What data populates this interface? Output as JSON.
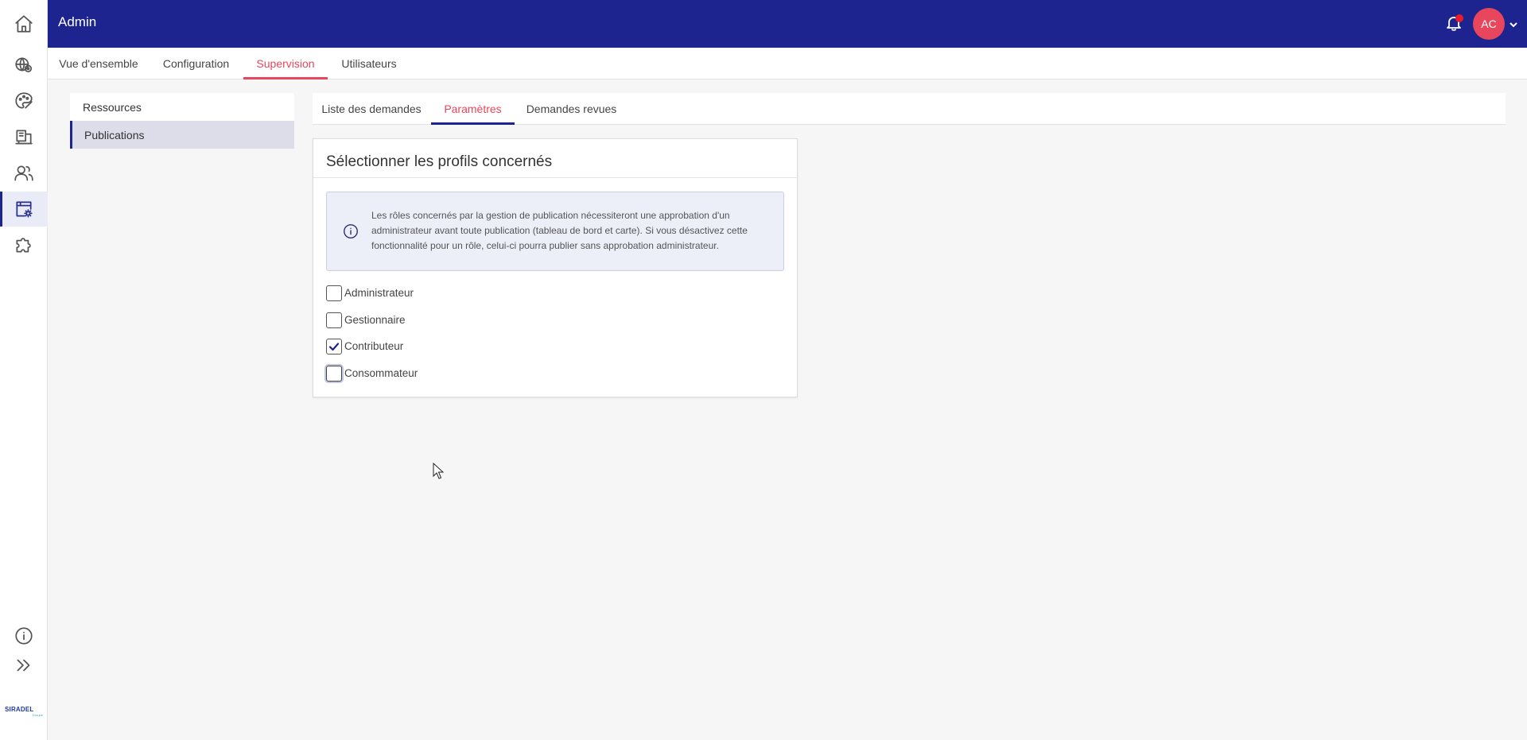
{
  "header": {
    "title": "Admin",
    "avatar_initials": "AC",
    "accent": "#1d238f"
  },
  "rail": {
    "icons": [
      "home-icon",
      "eye-globe-icon",
      "palette-icon",
      "book-icon",
      "users-icon",
      "admin-settings-icon",
      "puzzle-icon",
      "info-icon",
      "expand-icon"
    ],
    "logo_brand": "SIRADEL",
    "logo_tag": "Groupe"
  },
  "main_tabs": [
    {
      "label": "Vue d'ensemble"
    },
    {
      "label": "Configuration"
    },
    {
      "label": "Supervision",
      "active": true
    },
    {
      "label": "Utilisateurs"
    }
  ],
  "submenu": [
    {
      "label": "Ressources"
    },
    {
      "label": "Publications",
      "active": true
    }
  ],
  "sub_tabs": [
    {
      "label": "Liste des demandes"
    },
    {
      "label": "Paramètres",
      "active": true
    },
    {
      "label": "Demandes revues"
    }
  ],
  "card": {
    "title": "Sélectionner les profils concernés",
    "info": "Les rôles concernés par la gestion de publication nécessiteront une approbation d'un administrateur avant toute publication (tableau de bord et carte). Si vous désactivez cette fonctionnalité pour un rôle, celui-ci pourra publier sans approbation administrateur.",
    "profiles": [
      {
        "label": "Administrateur",
        "checked": false
      },
      {
        "label": "Gestionnaire",
        "checked": false
      },
      {
        "label": "Contributeur",
        "checked": true
      },
      {
        "label": "Consommateur",
        "checked": false
      }
    ]
  },
  "colors": {
    "accent_red": "#e8465d",
    "primary_blue": "#1d238f",
    "notification_dot": "#e81b2b"
  }
}
